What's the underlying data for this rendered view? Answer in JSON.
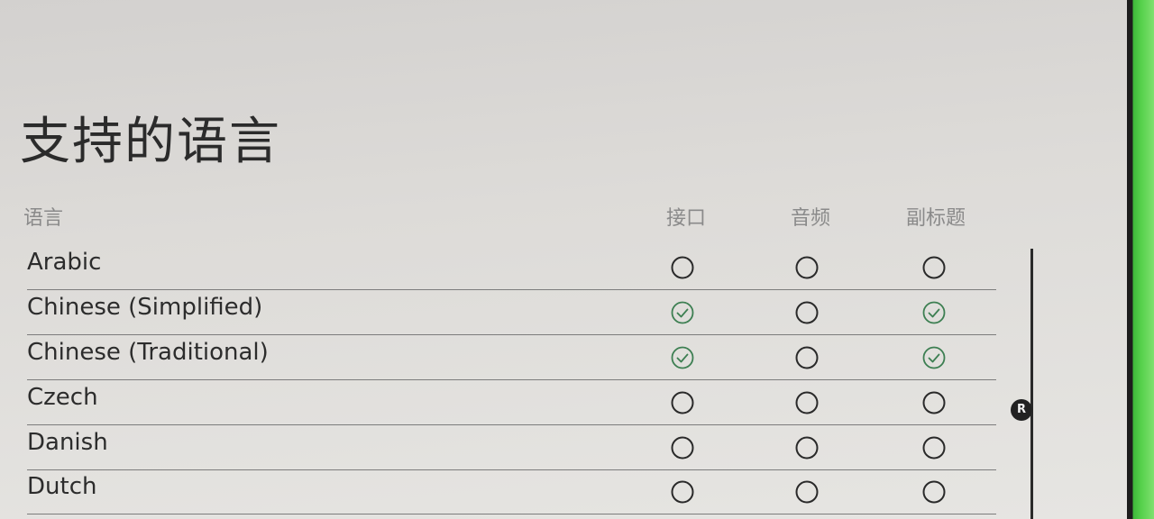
{
  "page": {
    "title": "支持的语言"
  },
  "table": {
    "headers": {
      "language": "语言",
      "interface": "接口",
      "audio": "音频",
      "subtitles": "副标题"
    },
    "rows": [
      {
        "name": "Arabic",
        "interface": false,
        "audio": false,
        "subtitles": false
      },
      {
        "name": "Chinese (Simplified)",
        "interface": true,
        "audio": false,
        "subtitles": true
      },
      {
        "name": "Chinese (Traditional)",
        "interface": true,
        "audio": false,
        "subtitles": true
      },
      {
        "name": "Czech",
        "interface": false,
        "audio": false,
        "subtitles": false
      },
      {
        "name": "Danish",
        "interface": false,
        "audio": false,
        "subtitles": false
      },
      {
        "name": "Dutch",
        "interface": false,
        "audio": false,
        "subtitles": false
      }
    ]
  },
  "scrollbar": {
    "thumb_label": "R"
  },
  "colors": {
    "check": "#3d7f52",
    "empty_circle": "#2a2a2a",
    "divider": "#7c7c7c",
    "header_text": "#8a8a8a"
  }
}
